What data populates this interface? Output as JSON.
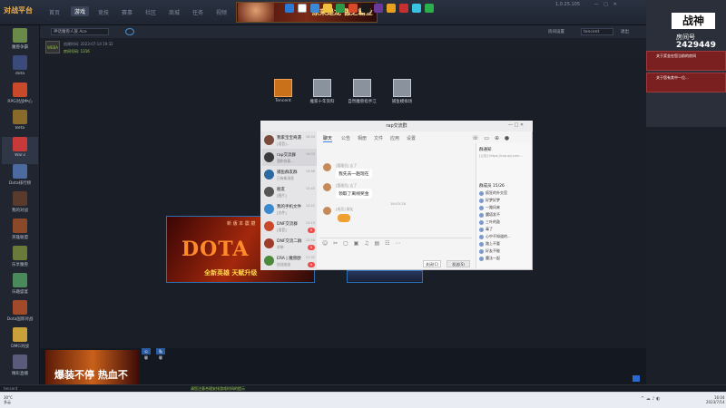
{
  "app": {
    "logo_text": "对战平台"
  },
  "nav": [
    "首页",
    "游戏",
    "竞技",
    "赛事",
    "社区",
    "商城",
    "任务",
    "视频"
  ],
  "banner": {
    "text": "原来是龙 傲之霸业"
  },
  "window_controls": "1.0.25.105",
  "sidebar": [
    {
      "label": "魔兽争霸",
      "color": "#6a8a4a"
    },
    {
      "label": "dota",
      "color": "#3a4a7a"
    },
    {
      "label": "RPG对战中心",
      "color": "#c84a2a"
    },
    {
      "label": "Beta",
      "color": "#8a6a2a"
    },
    {
      "label": "War3",
      "color": "#c83a3a"
    },
    {
      "label": "Dota排行榜",
      "color": "#4a6aa0"
    },
    {
      "label": "我的对战",
      "color": "#5a3a2a"
    },
    {
      "label": "英雄联盟",
      "color": "#8a4a2a"
    },
    {
      "label": "乐享魔兽",
      "color": "#6a7a3a"
    },
    {
      "label": "乐趣盛宴",
      "color": "#4a8a5a"
    },
    {
      "label": "Dota国际对战",
      "color": "#a04a2a"
    },
    {
      "label": "DMG对战",
      "color": "#caa03a"
    },
    {
      "label": "精彩直播",
      "color": "#5a5a7a"
    }
  ],
  "room": {
    "title": "神话魔兽人族 Ace",
    "line1": "创建时间: 2023-07-14 19:32",
    "line2": "房间号码: 1316",
    "logo": "WEBA"
  },
  "subhead_right": [
    "房间设置",
    "tencent",
    "退出"
  ],
  "desktop": [
    {
      "label": "Tencent",
      "color": "#c8701a"
    },
    {
      "label": "雅家十年资料"
    },
    {
      "label": "自然魔兽指手江"
    },
    {
      "label": "捕鱼模拟场"
    }
  ],
  "poster": {
    "title": "DOTA",
    "subtitle": "全新英雄 天赋升级",
    "top": "新 版 本 震 撼"
  },
  "chat": {
    "title": "rap交流群",
    "tabs": [
      "聊天",
      "公告",
      "相册",
      "文件",
      "应用",
      "设置"
    ],
    "conversations": [
      {
        "name": "我家宝宝奇遇",
        "msg": "[语音]...",
        "time": "16:04",
        "badge": "",
        "color": "#7a4a3a"
      },
      {
        "name": "rap交流群",
        "msg": "我和你真...",
        "time": "16:03",
        "badge": "",
        "color": "#3a3a3a"
      },
      {
        "name": "捕鱼群友群",
        "msg": "已有新消息",
        "time": "15:56",
        "badge": "",
        "color": "#2a6aa0"
      },
      {
        "name": "朋友",
        "msg": "[图片]",
        "time": "15:40",
        "badge": "",
        "color": "#555"
      },
      {
        "name": "我的手机文件",
        "msg": "[文件]",
        "time": "14:22",
        "badge": "",
        "color": "#3a8ad0"
      },
      {
        "name": "DNF交流群",
        "msg": "[语音]",
        "time": "13:10",
        "badge": "9",
        "color": "#c84a2a"
      },
      {
        "name": "DNF交流二群",
        "msg": "求带",
        "time": "12:50",
        "badge": "9",
        "color": "#a03a2a"
      },
      {
        "name": "ERA | 魔兽欧",
        "msg": "加油加油",
        "time": "11:32",
        "badge": "9",
        "color": "#4a8a3a"
      }
    ],
    "messages": [
      {
        "name": "[管理员] 吉了",
        "text": "我先去一趟现在"
      },
      {
        "name": "[管理员] 吉了",
        "text": "领取了离线奖金"
      },
      {
        "name": "[成员] 群友",
        "text": "发给 图片"
      }
    ],
    "msg_time": "16:03:28",
    "notice_title": "群通知",
    "notice": "[公告] https://rap.qq.com...",
    "members_title": "群成员 15/26",
    "members": [
      "疯狂的外交官",
      "好梦好梦",
      "一路风来",
      "魔塔发不",
      "三叶的鼓",
      "毒了",
      "心中不知道的...",
      "路上不要",
      "好友不能",
      "魔法一起"
    ],
    "close_label": "关闭(C)",
    "send_label": "发送(S)"
  },
  "right": {
    "brand": "战神",
    "label": "房间号",
    "number": "2429449",
    "notices": [
      "关于奖金在您当前的房间",
      "关于您有其中一位..."
    ]
  },
  "bottom": {
    "banner_text": "爆装不停 热血不",
    "tabs": [
      "公聊",
      "私聊"
    ]
  },
  "status": {
    "user": "tencent",
    "msg": "请您注意合理安排游戏时间的提示"
  },
  "taskbar": {
    "weather_temp": "30°C",
    "weather_text": "多云",
    "time": "16:04",
    "date": "2023/7/14"
  }
}
